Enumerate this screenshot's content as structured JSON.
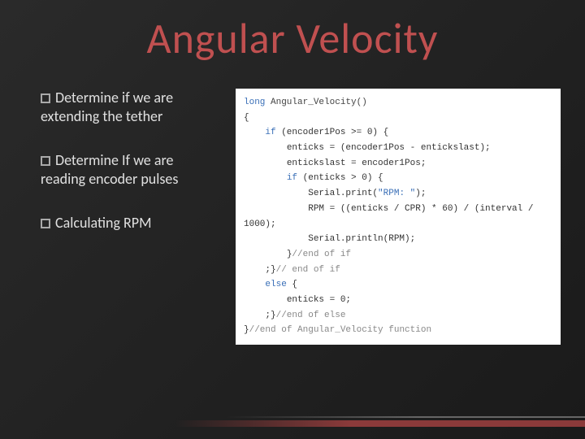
{
  "title": "Angular Velocity",
  "bullets": [
    "Determine if we are extending the tether",
    "Determine If we are reading encoder pulses",
    "Calculating RPM"
  ],
  "code": {
    "l1a": "long",
    "l1b": " Angular_Velocity()",
    "l2": "{",
    "l3a": "    if",
    "l3b": " (encoder1Pos >= 0) {",
    "l4": "        enticks = (encoder1Pos - entickslast);",
    "l5": "        entickslast = encoder1Pos;",
    "l6a": "        if",
    "l6b": " (enticks > 0) {",
    "l7a": "            Serial.print(",
    "l7b": "\"RPM: \"",
    "l7c": ");",
    "l8": "            RPM = ((enticks / CPR) * 60) / (interval / 1000);",
    "l9": "            Serial.println(RPM);",
    "l10a": "        }",
    "l10b": "//end of if",
    "l11a": "    ;}",
    "l11b": "// end of if",
    "l12a": "    else",
    "l12b": " {",
    "l13": "        enticks = 0;",
    "l14a": "    ;}",
    "l14b": "//end of else",
    "l15a": "}",
    "l15b": "//end of Angular_Velocity function"
  }
}
